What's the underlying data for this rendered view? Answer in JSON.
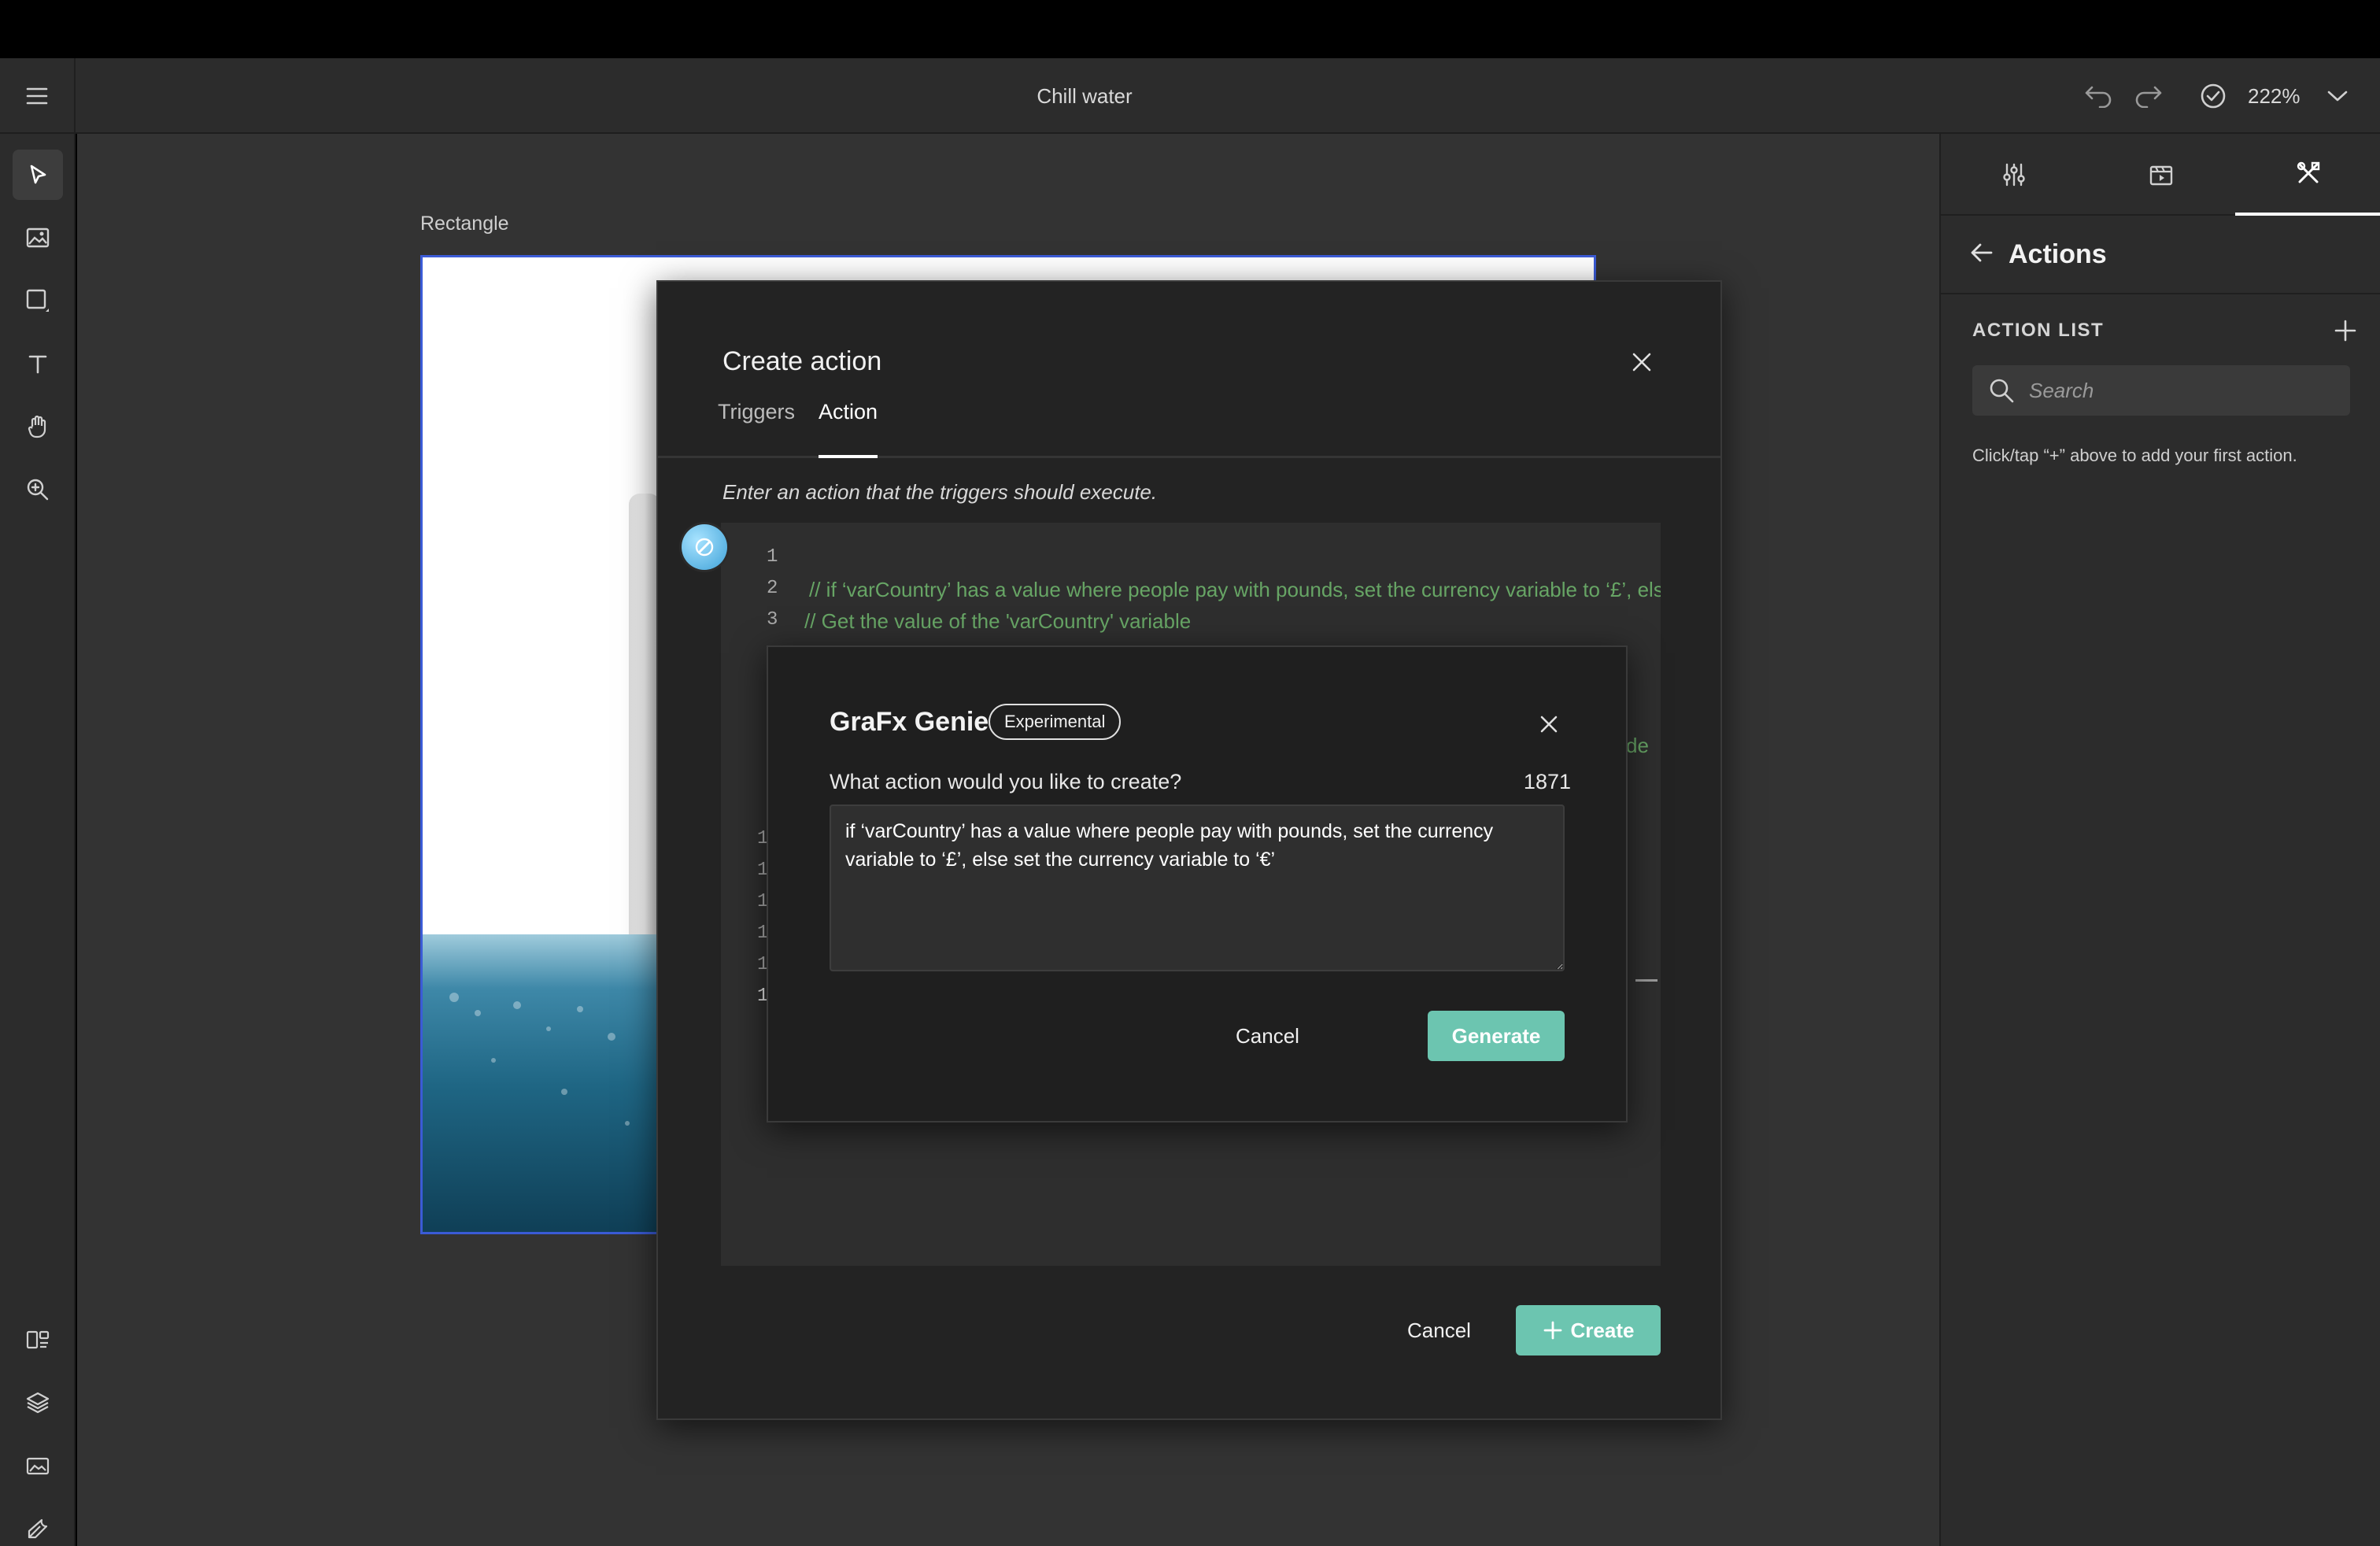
{
  "header": {
    "document_title": "Chill water",
    "zoom_level": "222%"
  },
  "canvas": {
    "frame_label": "Rectangle"
  },
  "right_panel": {
    "title": "Actions",
    "action_list_label": "ACTION LIST",
    "search_placeholder": "Search",
    "hint": "Click/tap “+” above to add your first action."
  },
  "create_action_modal": {
    "title": "Create action",
    "tabs": [
      {
        "label": "Triggers",
        "active": false
      },
      {
        "label": "Action",
        "active": true
      }
    ],
    "description": "Enter an action that the triggers should execute.",
    "editor": {
      "line_numbers": [
        "1",
        "2",
        "3"
      ],
      "lines": [
        "",
        "// if ‘varCountry’ has a value where people pay with pounds, set the currency variable to ‘£’, else set the currency variable to ‘€’",
        "// Get the value of the 'varCountry' variable"
      ],
      "partial_fragment": "de",
      "partial_line_numbers": [
        "1",
        "1",
        "1",
        "1",
        "1",
        "1"
      ]
    },
    "cancel_label": "Cancel",
    "create_label": "Create"
  },
  "genie_dialog": {
    "title": "GraFx Genie",
    "badge": "Experimental",
    "question": "What action would you like to create?",
    "char_count": "1871",
    "prompt_text": "if ‘varCountry’ has a value where people pay with pounds, set the currency variable to ‘£’, else set the currency variable to ‘€’",
    "cancel_label": "Cancel",
    "generate_label": "Generate"
  },
  "colors": {
    "accent": "#6cc5b0",
    "code_comment": "#67a565",
    "selection": "#3b5bd6"
  }
}
